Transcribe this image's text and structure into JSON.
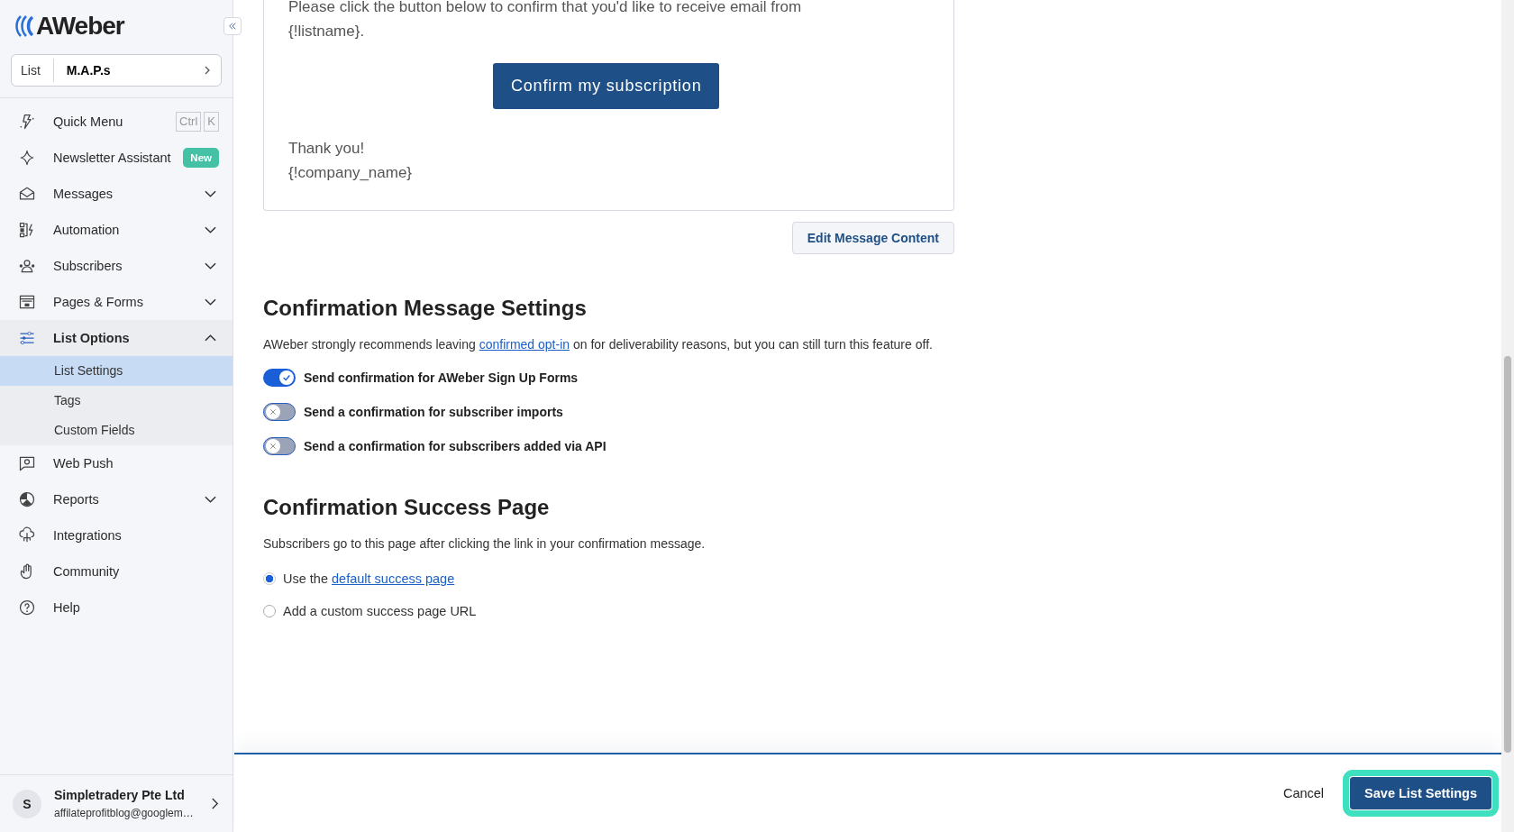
{
  "sidebar": {
    "logo": "AWeber",
    "list_selector": {
      "label": "List",
      "value": "M.A.P.s"
    },
    "items": [
      {
        "label": "Quick Menu",
        "shortcut": [
          "Ctrl",
          "K"
        ]
      },
      {
        "label": "Newsletter Assistant",
        "badge": "New"
      },
      {
        "label": "Messages",
        "expanded": false
      },
      {
        "label": "Automation",
        "expanded": false
      },
      {
        "label": "Subscribers",
        "expanded": false
      },
      {
        "label": "Pages & Forms",
        "expanded": false
      },
      {
        "label": "List Options",
        "expanded": true,
        "children": [
          {
            "label": "List Settings",
            "selected": true
          },
          {
            "label": "Tags",
            "selected": false
          },
          {
            "label": "Custom Fields",
            "selected": false
          }
        ]
      },
      {
        "label": "Web Push"
      },
      {
        "label": "Reports",
        "expanded": false
      },
      {
        "label": "Integrations"
      },
      {
        "label": "Community"
      },
      {
        "label": "Help"
      }
    ],
    "account": {
      "avatar": "S",
      "name": "Simpletradery Pte Ltd",
      "email": "affilateprofitblog@googlem…"
    }
  },
  "message_preview": {
    "lines": [
      "Please click the button below to confirm that you'd like to receive email from",
      "{!listname}."
    ],
    "button": "Confirm my subscription",
    "closing": [
      "Thank you!",
      "{!company_name}"
    ]
  },
  "edit_button": "Edit Message Content",
  "confirmation_settings": {
    "title": "Confirmation Message Settings",
    "description": {
      "before": "AWeber strongly recommends leaving ",
      "link": "confirmed opt-in",
      "after": " on for deliverability reasons, but you can still turn this feature off."
    },
    "toggles": [
      {
        "label": "Send confirmation for AWeber Sign Up Forms",
        "on": true
      },
      {
        "label": "Send a confirmation for subscriber imports",
        "on": false
      },
      {
        "label": "Send a confirmation for subscribers added via API",
        "on": false
      }
    ]
  },
  "success_page": {
    "title": "Confirmation Success Page",
    "description": "Subscribers go to this page after clicking the link in your confirmation message.",
    "options": [
      {
        "label": "Use the ",
        "link": "default success page",
        "selected": true
      },
      {
        "label": "Add a custom success page URL",
        "selected": false
      }
    ]
  },
  "footer": {
    "cancel": "Cancel",
    "save": "Save List Settings"
  }
}
